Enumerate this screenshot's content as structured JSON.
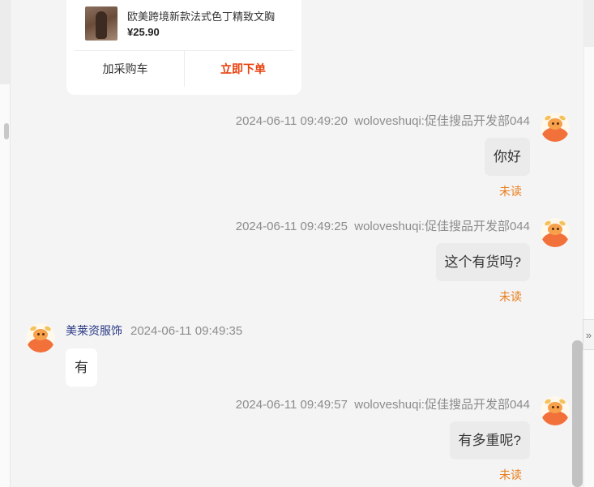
{
  "product_card": {
    "title": "欧美跨境新款法式色丁精致文胸",
    "price": "¥25.90",
    "add_cart_label": "加采购车",
    "order_now_label": "立即下单"
  },
  "messages": [
    {
      "direction": "out",
      "timestamp": "2024-06-11 09:49:20",
      "sender": "woloveshuqi:促佳搜品开发部044",
      "text": "你好",
      "status": "未读"
    },
    {
      "direction": "out",
      "timestamp": "2024-06-11 09:49:25",
      "sender": "woloveshuqi:促佳搜品开发部044",
      "text": "这个有货吗?",
      "status": "未读"
    },
    {
      "direction": "in",
      "sender": "美莱资服饰",
      "timestamp": "2024-06-11 09:49:35",
      "text": "有"
    },
    {
      "direction": "out",
      "timestamp": "2024-06-11 09:49:57",
      "sender": "woloveshuqi:促佳搜品开发部044",
      "text": "有多重呢?",
      "status": "未读"
    }
  ],
  "collapse_glyph": "»",
  "colors": {
    "order_button": "#e8410e",
    "unread": "#ea7d1a",
    "sender_name": "#2b3a87",
    "avatar_body": "#f2703a"
  }
}
